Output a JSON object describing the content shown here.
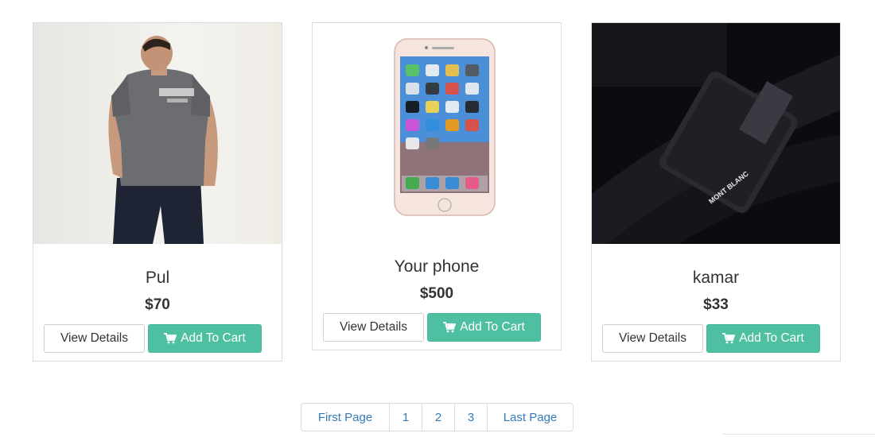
{
  "products": [
    {
      "name": "Pul",
      "price": "$70",
      "view_label": "View Details",
      "cart_label": "Add To Cart"
    },
    {
      "name": "Your phone",
      "price": "$500",
      "view_label": "View Details",
      "cart_label": "Add To Cart"
    },
    {
      "name": "kamar",
      "price": "$33",
      "view_label": "View Details",
      "cart_label": "Add To Cart"
    }
  ],
  "belt_image": {
    "brand_text": "MONT BLANC"
  },
  "pagination": {
    "first": "First Page",
    "pages": [
      "1",
      "2",
      "3"
    ],
    "last": "Last Page"
  },
  "colors": {
    "cart_button": "#4fbfa1",
    "link": "#337ab7",
    "border": "#dcdcdc"
  },
  "icons": {
    "cart": "shopping-cart-icon"
  }
}
